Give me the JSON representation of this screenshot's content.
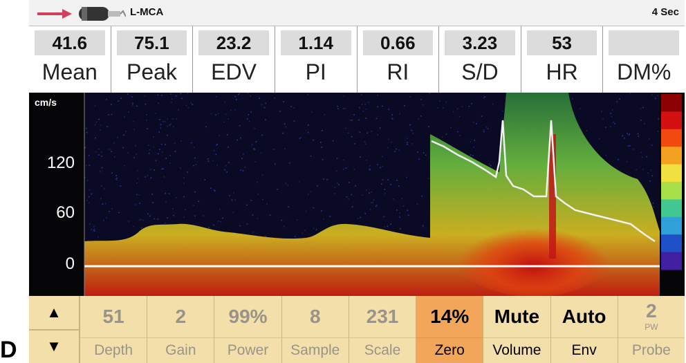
{
  "header": {
    "vessel": "L-MCA",
    "time_scale": "4 Sec",
    "probe_icon": "probe-icon",
    "direction_icon": "arrow-right-icon"
  },
  "measurements": [
    {
      "label": "Mean",
      "value": "41.6"
    },
    {
      "label": "Peak",
      "value": "75.1"
    },
    {
      "label": "EDV",
      "value": "23.2"
    },
    {
      "label": "PI",
      "value": "1.14"
    },
    {
      "label": "RI",
      "value": "0.66"
    },
    {
      "label": "S/D",
      "value": "3.23"
    },
    {
      "label": "HR",
      "value": "53"
    },
    {
      "label": "DM%",
      "value": ""
    }
  ],
  "spectrum": {
    "unit": "cm/s",
    "ticks": [
      "120",
      "60",
      "0"
    ],
    "colorbar": [
      "#8b0000",
      "#d41010",
      "#f04a10",
      "#f4a020",
      "#f0e040",
      "#a8e04a",
      "#40c890",
      "#30a0d8",
      "#2050c8",
      "#4020a0"
    ]
  },
  "controls": {
    "up_icon": "triangle-up-icon",
    "down_icon": "triangle-down-icon",
    "items": [
      {
        "value": "51",
        "label": "Depth"
      },
      {
        "value": "2",
        "label": "Gain"
      },
      {
        "value": "99%",
        "label": "Power"
      },
      {
        "value": "8",
        "label": "Sample"
      },
      {
        "value": "231",
        "label": "Scale"
      },
      {
        "value": "14%",
        "label": "Zero"
      },
      {
        "value": "Mute",
        "label": "Volume"
      },
      {
        "value": "Auto",
        "label": "Env"
      },
      {
        "value": "2",
        "sub": "PW",
        "label": "Probe"
      }
    ]
  },
  "panel_letter": "D"
}
